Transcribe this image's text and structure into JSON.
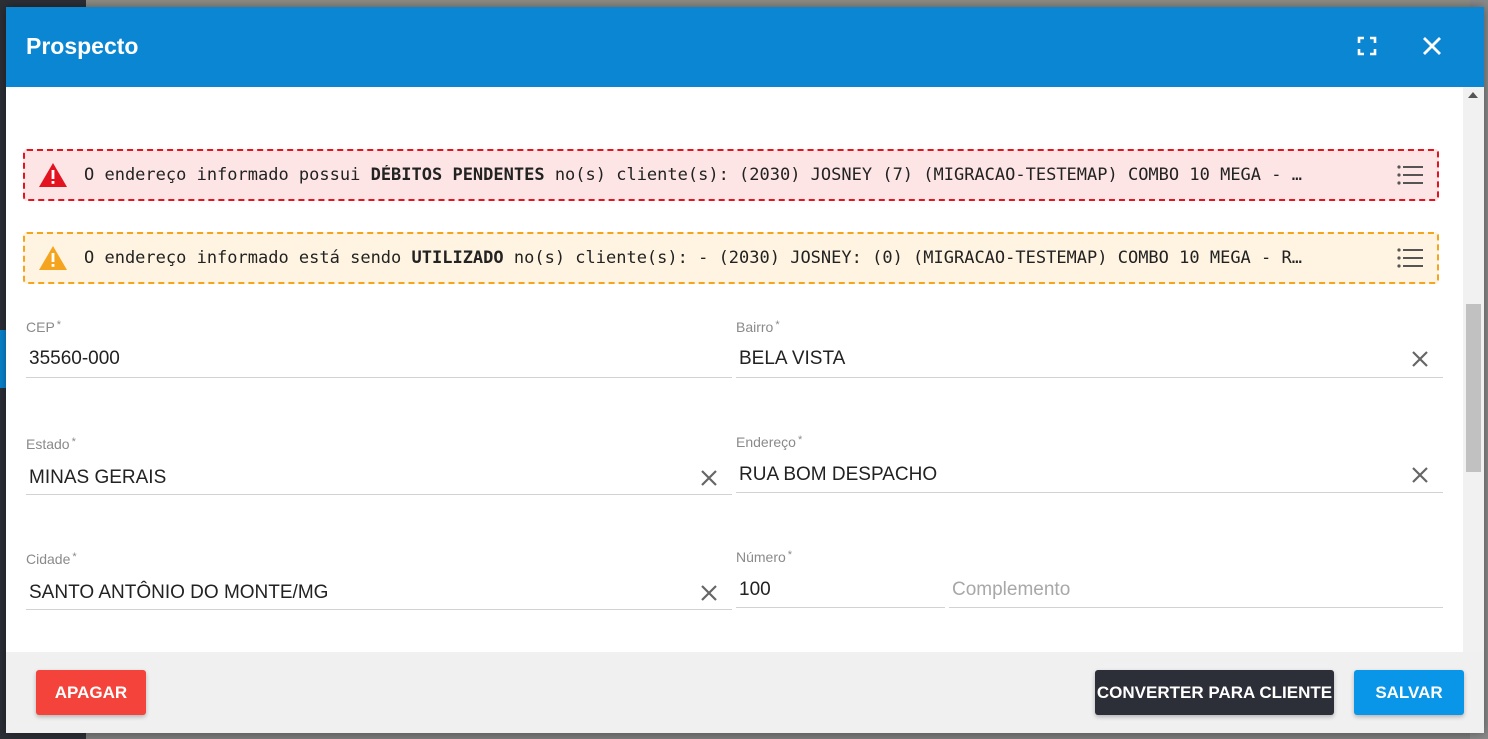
{
  "modal": {
    "title": "Prospecto",
    "expand_icon": "fullscreen-icon",
    "close_icon": "close-icon"
  },
  "alerts": [
    {
      "type": "danger",
      "color": "#e3141f",
      "text_before": "O endereço informado possui ",
      "text_bold": "DÉBITOS PENDENTES",
      "text_after": " no(s) cliente(s): (2030) JOSNEY (7) (MIGRACAO-TESTEMAP) COMBO 10 MEGA - …",
      "icon": "warning-icon",
      "list_icon": "list-icon"
    },
    {
      "type": "warning",
      "color": "#f5a41e",
      "text_before": "O endereço informado está sendo ",
      "text_bold": "UTILIZADO",
      "text_after": " no(s) cliente(s): - (2030) JOSNEY: (0) (MIGRACAO-TESTEMAP) COMBO 10 MEGA - R…",
      "icon": "warning-icon",
      "list_icon": "list-icon"
    }
  ],
  "form": {
    "cep": {
      "label": "CEP",
      "required": "*",
      "value": "35560-000"
    },
    "bairro": {
      "label": "Bairro",
      "required": "*",
      "value": "BELA VISTA"
    },
    "estado": {
      "label": "Estado",
      "required": "*",
      "value": "MINAS GERAIS"
    },
    "endereco": {
      "label": "Endereço",
      "required": "*",
      "value": "RUA BOM DESPACHO"
    },
    "cidade": {
      "label": "Cidade",
      "required": "*",
      "value": "SANTO ANTÔNIO DO MONTE/MG"
    },
    "numero": {
      "label": "Número",
      "required": "*",
      "value": "100"
    },
    "complemento": {
      "placeholder": "Complemento",
      "value": ""
    }
  },
  "footer": {
    "apagar_label": "APAGAR",
    "converter_label": "CONVERTER PARA CLIENTE",
    "salvar_label": "SALVAR"
  },
  "colors": {
    "header": "#0a86d3",
    "apagar": "#f4433a",
    "converter": "#2c2f38",
    "salvar": "#0a96e8"
  }
}
